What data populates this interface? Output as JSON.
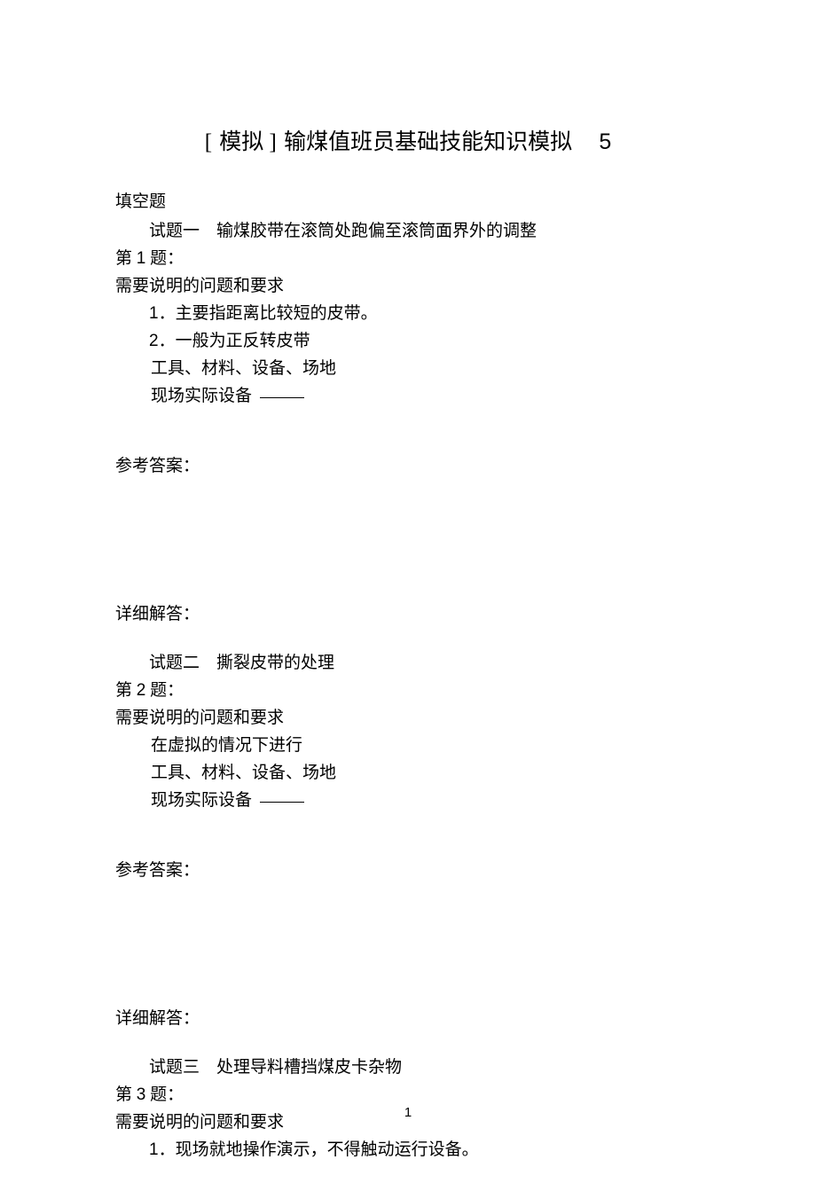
{
  "title": {
    "bracket_open": "[",
    "label": "模拟",
    "bracket_close": "]",
    "main": "输煤值班员基础技能知识模拟",
    "number": "5"
  },
  "section_heading": "填空题",
  "q1": {
    "subtitle": "试题一　输煤胶带在滚筒处跑偏至滚筒面界外的调整",
    "number_prefix": "第",
    "number": "1",
    "number_suffix": "题：",
    "req_heading": "需要说明的问题和要求",
    "item1_num": "1",
    "item1_text": "．主要指距离比较短的皮带。",
    "item2_num": "2",
    "item2_text": "．一般为正反转皮带",
    "line_tools": "工具、材料、设备、场地",
    "line_device": "现场实际设备",
    "answer_label": "参考答案：",
    "detail_label": "详细解答："
  },
  "q2": {
    "subtitle": "试题二　撕裂皮带的处理",
    "number_prefix": "第",
    "number": "2",
    "number_suffix": "题：",
    "req_heading": "需要说明的问题和要求",
    "line_virtual": "在虚拟的情况下进行",
    "line_tools": "工具、材料、设备、场地",
    "line_device": "现场实际设备",
    "answer_label": "参考答案：",
    "detail_label": "详细解答："
  },
  "q3": {
    "subtitle": "试题三　处理导料槽挡煤皮卡杂物",
    "number_prefix": "第",
    "number": "3",
    "number_suffix": "题：",
    "req_heading": "需要说明的问题和要求",
    "item1_num": "1",
    "item1_text": "．现场就地操作演示，不得触动运行设备。"
  },
  "page_number": "1"
}
